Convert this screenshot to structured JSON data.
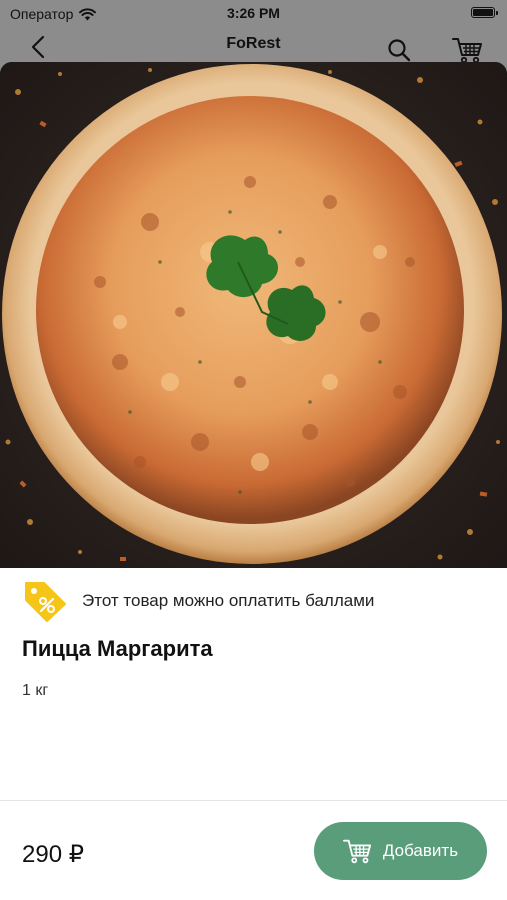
{
  "status_bar": {
    "carrier": "Оператор",
    "time": "3:26 PM"
  },
  "nav": {
    "title": "FoRest",
    "back_icon": "chevron-left-icon",
    "search_icon": "search-icon",
    "cart_icon": "cart-icon"
  },
  "product": {
    "image_subject": "pizza-image",
    "points_text": "Этот товар можно оплатить баллами",
    "title": "Пицца Маргарита",
    "weight": "1 кг",
    "price": "290 ₽"
  },
  "actions": {
    "add_label": "Добавить"
  },
  "colors": {
    "accent_green": "#5a9d7b",
    "points_badge": "#f5c518",
    "top_bar_gray": "#8c8c8c"
  }
}
